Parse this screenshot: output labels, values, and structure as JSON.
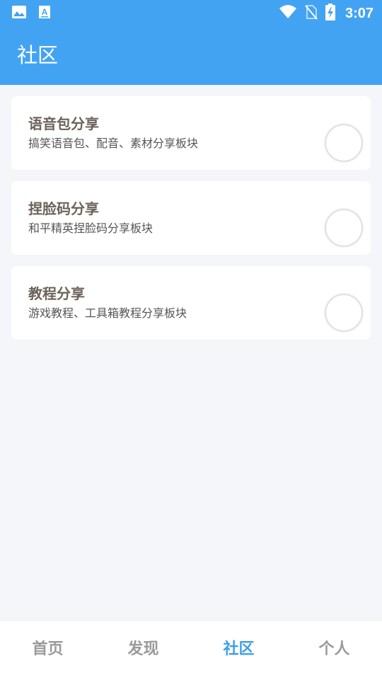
{
  "status_bar": {
    "time": "3:07",
    "icons": [
      "image-icon",
      "font-a-icon",
      "wifi-icon",
      "no-sim-icon",
      "battery-charging-icon"
    ]
  },
  "header": {
    "title": "社区"
  },
  "colors": {
    "accent": "#43a3f3",
    "nav_active": "#3d9ee9",
    "nav_inactive": "#9a9a9a",
    "background": "#f4f6f9"
  },
  "sections": [
    {
      "title": "语音包分享",
      "description": "搞笑语音包、配音、素材分享板块"
    },
    {
      "title": "捏脸码分享",
      "description": "和平精英捏脸码分享板块"
    },
    {
      "title": "教程分享",
      "description": "游戏教程、工具箱教程分享板块"
    }
  ],
  "bottom_nav": {
    "items": [
      {
        "label": "首页"
      },
      {
        "label": "发现"
      },
      {
        "label": "社区"
      },
      {
        "label": "个人"
      }
    ],
    "active_label": "社区"
  }
}
